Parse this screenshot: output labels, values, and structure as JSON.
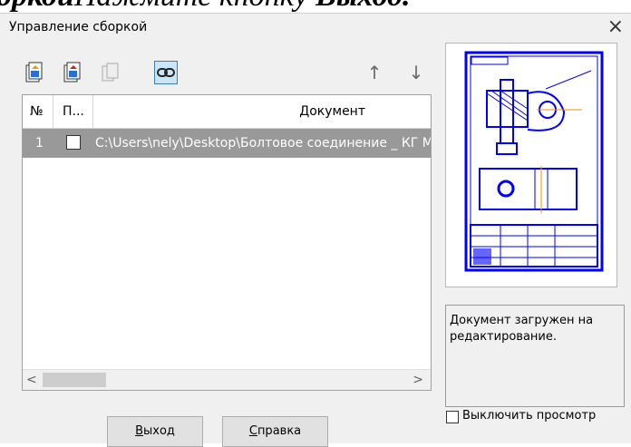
{
  "background_text": {
    "part1": "оркой",
    "part2": "Нажмите кнопку",
    "part3": "Выход."
  },
  "dialog": {
    "title": "Управление сборкой",
    "close_glyph": "×"
  },
  "toolbar": {
    "icons": [
      "add-document-icon",
      "add-document-red-icon",
      "copy-document-icon",
      "link-icon",
      "arrow-up-icon",
      "arrow-down-icon"
    ],
    "up_glyph": "↑",
    "down_glyph": "↓"
  },
  "table": {
    "headers": {
      "num": "№",
      "p": "П...",
      "document": "Документ"
    },
    "rows": [
      {
        "num": "1",
        "checked": false,
        "document": "C:\\Users\\nely\\Desktop\\Болтовое соединение _ КГ М"
      }
    ],
    "scroll_left": "<",
    "scroll_right": ">"
  },
  "status": {
    "message": "Документ загружен на редактирование."
  },
  "buttons": {
    "exit_first": "В",
    "exit_rest": "ыход",
    "help_first": "С",
    "help_rest": "правка"
  },
  "disable_preview": {
    "label": "Выключить просмотр",
    "checked": false
  },
  "colors": {
    "selected_row": "#999999",
    "drawing_blue": "#0000ff",
    "dialog_bg": "#f0f0f0"
  }
}
